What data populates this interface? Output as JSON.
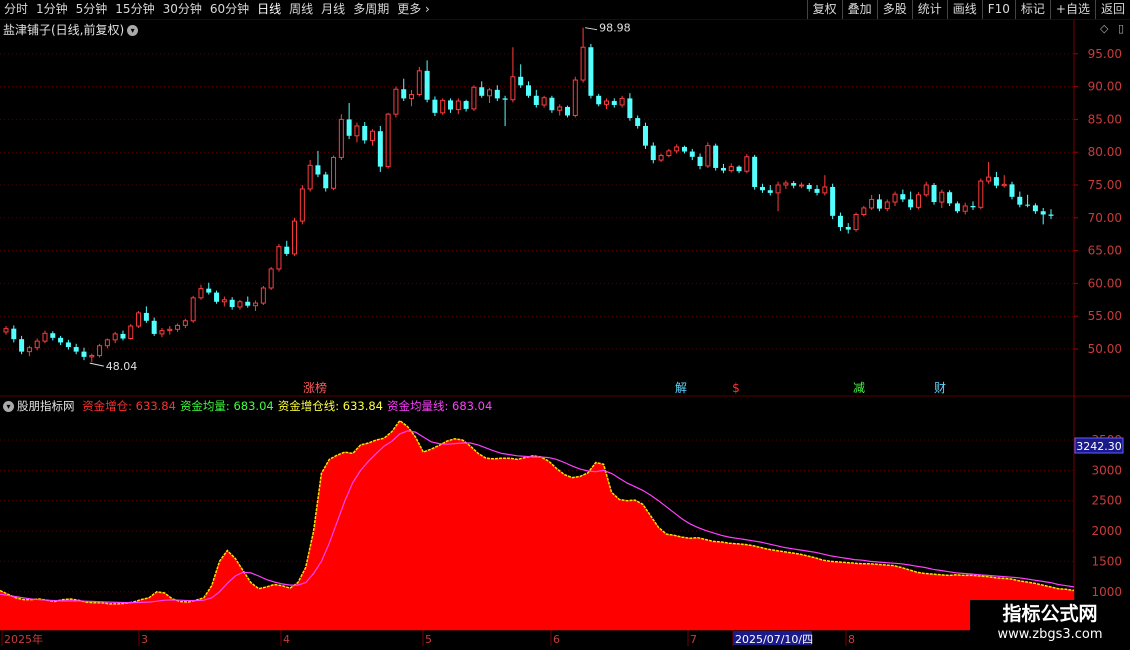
{
  "toolbar": {
    "periods": [
      "分时",
      "1分钟",
      "5分钟",
      "15分钟",
      "30分钟",
      "60分钟",
      "日线",
      "周线",
      "月线",
      "多周期",
      "更多"
    ],
    "active_period": "日线",
    "right_buttons": [
      "复权",
      "叠加",
      "多股",
      "统计",
      "画线",
      "F10",
      "标记",
      "+自选",
      "返回"
    ]
  },
  "main_panel": {
    "title": "盐津铺子(日线,前复权)",
    "price_axis": [
      "95.00",
      "90.00",
      "85.00",
      "80.00",
      "75.00",
      "70.00",
      "65.00",
      "60.00",
      "55.00",
      "50.00"
    ],
    "high_label": "98.98",
    "low_label": "48.04",
    "event_markers": [
      {
        "text": "涨榜",
        "color": "#ff5a5a"
      },
      {
        "text": "解",
        "color": "#5fd7ff"
      },
      {
        "text": "$",
        "color": "#ff3030"
      },
      {
        "text": "减",
        "color": "#40ff40"
      },
      {
        "text": "财",
        "color": "#5fd7ff"
      }
    ]
  },
  "indicator_panel": {
    "name": "股朋指标网",
    "legends": [
      {
        "label": "资金增仓: 633.84",
        "color": "#ff3030"
      },
      {
        "label": "资金均量: 683.04",
        "color": "#40ff40"
      },
      {
        "label": "资金增仓线: 633.84",
        "color": "#ffff40"
      },
      {
        "label": "资金均量线: 683.04",
        "color": "#ff40ff"
      }
    ],
    "axis": [
      "3500",
      "3000",
      "2500",
      "2000",
      "1500",
      "1000"
    ],
    "cursor_value": "3242.30"
  },
  "time_axis": {
    "labels": [
      "2025年",
      "3",
      "4",
      "5",
      "6",
      "7",
      "2025/07/10/四",
      "8"
    ]
  },
  "watermark": {
    "title": "指标公式网",
    "url": "www.zbgs3.com"
  },
  "colors": {
    "up": "#ff3c3c",
    "down": "#54ffff",
    "fill": "#ff0000",
    "ma": "#ff40ff",
    "line": "#ffdd00"
  },
  "chart_data": {
    "type": "candlestick",
    "price_range": [
      45,
      100
    ],
    "candles_ohlc": [
      [
        52.6,
        53.5,
        52.2,
        53.1
      ],
      [
        53.1,
        53.6,
        51.0,
        51.5
      ],
      [
        51.5,
        52.0,
        49.2,
        49.6
      ],
      [
        49.6,
        50.5,
        48.9,
        50.2
      ],
      [
        50.2,
        51.6,
        49.8,
        51.2
      ],
      [
        51.2,
        52.8,
        50.9,
        52.4
      ],
      [
        52.4,
        52.7,
        51.3,
        51.7
      ],
      [
        51.7,
        52.0,
        50.6,
        51.0
      ],
      [
        51.0,
        51.4,
        49.9,
        50.3
      ],
      [
        50.3,
        50.8,
        49.2,
        49.6
      ],
      [
        49.6,
        50.2,
        48.3,
        48.8
      ],
      [
        48.8,
        49.3,
        48.0,
        49.0
      ],
      [
        49.0,
        50.8,
        48.7,
        50.5
      ],
      [
        50.5,
        51.6,
        50.1,
        51.4
      ],
      [
        51.4,
        52.6,
        50.9,
        52.3
      ],
      [
        52.3,
        52.8,
        51.3,
        51.6
      ],
      [
        51.6,
        53.8,
        51.4,
        53.5
      ],
      [
        53.5,
        55.8,
        53.2,
        55.5
      ],
      [
        55.5,
        56.5,
        54.0,
        54.3
      ],
      [
        54.3,
        54.8,
        52.0,
        52.3
      ],
      [
        52.3,
        53.2,
        51.8,
        52.8
      ],
      [
        52.8,
        53.5,
        52.2,
        53.0
      ],
      [
        53.0,
        53.9,
        52.6,
        53.6
      ],
      [
        53.6,
        54.6,
        53.2,
        54.3
      ],
      [
        54.3,
        58.1,
        54.0,
        57.8
      ],
      [
        57.8,
        59.8,
        57.5,
        59.2
      ],
      [
        59.2,
        60.1,
        58.3,
        58.6
      ],
      [
        58.6,
        58.9,
        56.9,
        57.2
      ],
      [
        57.2,
        58.0,
        56.5,
        57.5
      ],
      [
        57.5,
        57.9,
        56.0,
        56.4
      ],
      [
        56.4,
        57.5,
        56.0,
        57.2
      ],
      [
        57.2,
        58.0,
        56.3,
        56.6
      ],
      [
        56.6,
        57.4,
        55.8,
        57.0
      ],
      [
        57.0,
        59.6,
        56.7,
        59.3
      ],
      [
        59.3,
        62.5,
        59.0,
        62.2
      ],
      [
        62.2,
        66.0,
        61.8,
        65.6
      ],
      [
        65.6,
        66.5,
        64.2,
        64.5
      ],
      [
        64.5,
        70.0,
        64.2,
        69.5
      ],
      [
        69.5,
        75.0,
        69.0,
        74.4
      ],
      [
        74.4,
        78.8,
        74.0,
        78.0
      ],
      [
        78.0,
        80.2,
        76.2,
        76.6
      ],
      [
        76.6,
        77.0,
        74.0,
        74.5
      ],
      [
        74.5,
        79.5,
        74.2,
        79.2
      ],
      [
        79.2,
        85.8,
        78.8,
        85.0
      ],
      [
        85.0,
        87.5,
        82.0,
        82.5
      ],
      [
        82.5,
        84.5,
        81.5,
        84.0
      ],
      [
        84.0,
        84.6,
        81.3,
        81.8
      ],
      [
        81.8,
        83.5,
        81.0,
        83.2
      ],
      [
        83.2,
        84.0,
        77.0,
        77.8
      ],
      [
        77.8,
        86.0,
        77.5,
        85.8
      ],
      [
        85.8,
        90.0,
        85.3,
        89.6
      ],
      [
        89.6,
        91.2,
        87.8,
        88.2
      ],
      [
        88.2,
        89.5,
        87.0,
        88.8
      ],
      [
        88.8,
        93.0,
        88.5,
        92.4
      ],
      [
        92.4,
        94.0,
        87.6,
        88.0
      ],
      [
        88.0,
        88.5,
        85.5,
        86.0
      ],
      [
        86.0,
        88.2,
        85.7,
        87.9
      ],
      [
        87.9,
        88.2,
        86.0,
        86.5
      ],
      [
        86.5,
        88.2,
        85.8,
        87.8
      ],
      [
        87.8,
        88.0,
        86.2,
        86.6
      ],
      [
        86.6,
        90.2,
        86.3,
        89.9
      ],
      [
        89.9,
        90.8,
        88.3,
        88.6
      ],
      [
        88.6,
        89.8,
        87.5,
        89.5
      ],
      [
        89.5,
        90.2,
        87.8,
        88.2
      ],
      [
        88.2,
        88.6,
        84.0,
        88.0
      ],
      [
        88.0,
        96.0,
        87.6,
        91.5
      ],
      [
        91.5,
        93.4,
        89.8,
        90.2
      ],
      [
        90.2,
        90.8,
        88.3,
        88.6
      ],
      [
        88.6,
        89.5,
        86.8,
        87.2
      ],
      [
        87.2,
        88.6,
        86.8,
        88.3
      ],
      [
        88.3,
        88.6,
        86.0,
        86.4
      ],
      [
        86.4,
        87.3,
        85.6,
        86.9
      ],
      [
        86.9,
        87.1,
        85.3,
        85.6
      ],
      [
        85.6,
        91.5,
        85.3,
        91.0
      ],
      [
        91.0,
        98.98,
        90.6,
        96.0
      ],
      [
        96.0,
        96.5,
        88.2,
        88.6
      ],
      [
        88.6,
        88.9,
        87.0,
        87.3
      ],
      [
        87.3,
        88.2,
        86.6,
        87.8
      ],
      [
        87.8,
        88.2,
        86.8,
        87.2
      ],
      [
        87.2,
        88.6,
        86.8,
        88.2
      ],
      [
        88.2,
        89.0,
        84.8,
        85.2
      ],
      [
        85.2,
        85.6,
        83.6,
        84.0
      ],
      [
        84.0,
        84.5,
        80.5,
        81.0
      ],
      [
        81.0,
        81.5,
        78.3,
        78.8
      ],
      [
        78.8,
        79.8,
        78.5,
        79.5
      ],
      [
        79.5,
        80.5,
        79.2,
        80.2
      ],
      [
        80.2,
        81.2,
        79.8,
        80.8
      ],
      [
        80.8,
        81.0,
        79.8,
        80.1
      ],
      [
        80.1,
        80.5,
        78.8,
        79.3
      ],
      [
        79.3,
        79.8,
        77.4,
        77.9
      ],
      [
        77.9,
        81.5,
        77.6,
        81.0
      ],
      [
        81.0,
        81.3,
        77.2,
        77.6
      ],
      [
        77.6,
        78.2,
        76.8,
        77.2
      ],
      [
        77.2,
        78.3,
        76.9,
        77.8
      ],
      [
        77.8,
        78.0,
        76.8,
        77.1
      ],
      [
        77.1,
        79.7,
        76.8,
        79.3
      ],
      [
        79.3,
        79.6,
        74.3,
        74.7
      ],
      [
        74.7,
        75.2,
        73.8,
        74.2
      ],
      [
        74.2,
        75.0,
        73.4,
        73.8
      ],
      [
        73.8,
        75.5,
        71.0,
        75.0
      ],
      [
        75.0,
        75.7,
        74.4,
        75.3
      ],
      [
        75.3,
        75.6,
        74.5,
        74.9
      ],
      [
        74.9,
        75.4,
        74.5,
        75.0
      ],
      [
        75.0,
        75.3,
        74.0,
        74.4
      ],
      [
        74.4,
        75.0,
        73.4,
        73.8
      ],
      [
        73.8,
        76.5,
        73.4,
        74.7
      ],
      [
        74.7,
        75.2,
        69.8,
        70.3
      ],
      [
        70.3,
        70.8,
        68.0,
        68.6
      ],
      [
        68.6,
        69.2,
        67.6,
        68.2
      ],
      [
        68.2,
        70.8,
        67.9,
        70.5
      ],
      [
        70.5,
        71.8,
        70.2,
        71.5
      ],
      [
        71.5,
        73.5,
        71.2,
        72.8
      ],
      [
        72.8,
        73.6,
        71.0,
        71.4
      ],
      [
        71.4,
        72.8,
        71.0,
        72.4
      ],
      [
        72.4,
        74.0,
        71.8,
        73.6
      ],
      [
        73.6,
        74.3,
        72.4,
        72.8
      ],
      [
        72.8,
        74.0,
        71.2,
        71.6
      ],
      [
        71.6,
        73.9,
        71.3,
        73.5
      ],
      [
        73.5,
        75.5,
        73.2,
        75.0
      ],
      [
        75.0,
        75.3,
        72.0,
        72.4
      ],
      [
        72.4,
        74.3,
        71.5,
        73.9
      ],
      [
        73.9,
        74.2,
        71.8,
        72.2
      ],
      [
        72.2,
        72.5,
        70.7,
        71.0
      ],
      [
        71.0,
        72.3,
        70.5,
        71.8
      ],
      [
        71.8,
        72.5,
        71.2,
        71.6
      ],
      [
        71.6,
        76.0,
        71.3,
        75.6
      ],
      [
        75.6,
        78.5,
        75.2,
        76.2
      ],
      [
        76.2,
        77.0,
        74.5,
        74.9
      ],
      [
        74.9,
        76.5,
        74.6,
        75.1
      ],
      [
        75.1,
        75.5,
        72.8,
        73.2
      ],
      [
        73.2,
        74.0,
        71.6,
        72.0
      ],
      [
        72.0,
        73.5,
        71.6,
        71.9
      ],
      [
        71.9,
        72.2,
        70.6,
        71.0
      ],
      [
        71.0,
        71.5,
        69.0,
        70.5
      ],
      [
        70.5,
        71.3,
        69.8,
        70.3
      ]
    ],
    "indicator": {
      "y_range": [
        600,
        3800
      ],
      "fund_position": [
        1020,
        960,
        900,
        870,
        870,
        880,
        860,
        840,
        870,
        880,
        860,
        830,
        820,
        820,
        800,
        800,
        810,
        830,
        870,
        900,
        1000,
        980,
        880,
        840,
        830,
        860,
        900,
        1100,
        1500,
        1680,
        1550,
        1350,
        1150,
        1050,
        1080,
        1120,
        1100,
        1060,
        1150,
        1400,
        2000,
        2950,
        3180,
        3250,
        3300,
        3280,
        3420,
        3450,
        3500,
        3530,
        3640,
        3820,
        3720,
        3550,
        3300,
        3350,
        3410,
        3480,
        3520,
        3500,
        3400,
        3280,
        3200,
        3190,
        3200,
        3200,
        3180,
        3210,
        3240,
        3220,
        3150,
        3030,
        2930,
        2880,
        2900,
        2960,
        3130,
        3100,
        2640,
        2520,
        2500,
        2510,
        2440,
        2250,
        2060,
        1950,
        1930,
        1900,
        1880,
        1890,
        1860,
        1830,
        1820,
        1800,
        1790,
        1780,
        1760,
        1730,
        1700,
        1680,
        1660,
        1640,
        1620,
        1590,
        1560,
        1520,
        1500,
        1490,
        1480,
        1470,
        1460,
        1460,
        1450,
        1440,
        1430,
        1400,
        1360,
        1320,
        1300,
        1290,
        1280,
        1270,
        1280,
        1270,
        1270,
        1260,
        1250,
        1230,
        1220,
        1210,
        1180,
        1160,
        1140,
        1110,
        1080,
        1050,
        1040,
        1020
      ],
      "fund_average": [
        960,
        940,
        920,
        900,
        880,
        870,
        860,
        855,
        850,
        850,
        850,
        845,
        840,
        835,
        830,
        825,
        822,
        822,
        825,
        830,
        845,
        860,
        865,
        860,
        855,
        855,
        860,
        900,
        1000,
        1140,
        1260,
        1320,
        1310,
        1260,
        1200,
        1160,
        1130,
        1110,
        1110,
        1150,
        1300,
        1500,
        1800,
        2150,
        2500,
        2800,
        3000,
        3150,
        3280,
        3400,
        3480,
        3600,
        3650,
        3630,
        3550,
        3470,
        3440,
        3430,
        3440,
        3450,
        3450,
        3420,
        3370,
        3320,
        3280,
        3260,
        3240,
        3230,
        3220,
        3220,
        3210,
        3180,
        3130,
        3070,
        3020,
        2990,
        2980,
        3000,
        2950,
        2870,
        2790,
        2730,
        2670,
        2590,
        2500,
        2400,
        2300,
        2200,
        2120,
        2060,
        2010,
        1970,
        1930,
        1900,
        1880,
        1860,
        1840,
        1820,
        1790,
        1760,
        1730,
        1710,
        1690,
        1670,
        1650,
        1620,
        1590,
        1570,
        1550,
        1530,
        1520,
        1500,
        1490,
        1480,
        1470,
        1460,
        1440,
        1420,
        1400,
        1370,
        1350,
        1330,
        1310,
        1300,
        1290,
        1280,
        1270,
        1260,
        1250,
        1240,
        1230,
        1210,
        1190,
        1170,
        1150,
        1120,
        1100,
        1080
      ]
    }
  }
}
